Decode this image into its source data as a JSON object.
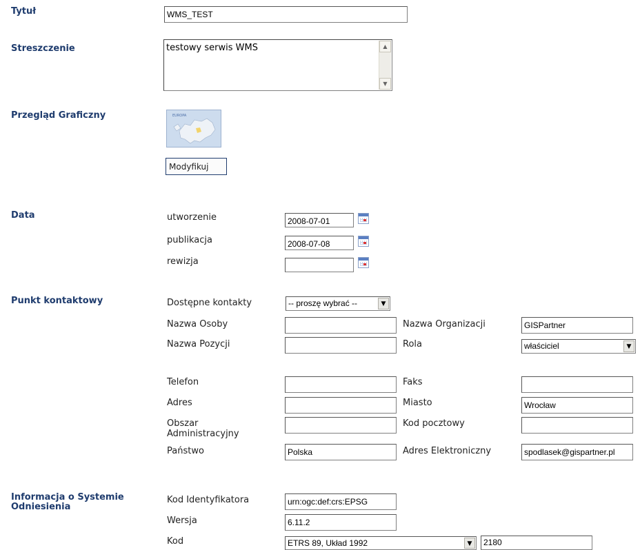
{
  "sections": {
    "title": "Tytuł",
    "abstract": "Streszczenie",
    "graphic_overview": "Przegląd Graficzny",
    "date": "Data",
    "contact_point": "Punkt kontaktowy",
    "crs_info": "Informacja o Systemie Odniesienia"
  },
  "title_value": "WMS_TEST",
  "abstract_value": "testowy serwis WMS",
  "graphic": {
    "modify_button": "Modyfikuj",
    "thumb_text": "EUROPA"
  },
  "dates": {
    "created_label": "utworzenie",
    "created_value": "2008-07-01",
    "published_label": "publikacja",
    "published_value": "2008-07-08",
    "revision_label": "rewizja",
    "revision_value": ""
  },
  "contact": {
    "available_label": "Dostępne kontakty",
    "available_value": "-- proszę wybrać --",
    "person_label": "Nazwa Osoby",
    "person_value": "",
    "org_label": "Nazwa Organizacji",
    "org_value": "GISPartner",
    "position_label": "Nazwa Pozycji",
    "position_value": "",
    "role_label": "Rola",
    "role_value": "właściciel",
    "phone_label": "Telefon",
    "phone_value": "",
    "fax_label": "Faks",
    "fax_value": "",
    "address_label": "Adres",
    "address_value": "",
    "city_label": "Miasto",
    "city_value": "Wrocław",
    "admin_area_label": "Obszar Administracyjny",
    "admin_area_value": "",
    "postal_label": "Kod pocztowy",
    "postal_value": "",
    "country_label": "Państwo",
    "country_value": "Polska",
    "email_label": "Adres Elektroniczny",
    "email_value": "spodlasek@gispartner.pl"
  },
  "crs": {
    "id_code_label": "Kod Identyfikatora",
    "id_code_value": "urn:ogc:def:crs:EPSG",
    "version_label": "Wersja",
    "version_value": "6.11.2",
    "code_label": "Kod",
    "code_select_value": "ETRS 89, Układ 1992",
    "code_value": "2180"
  },
  "icons": {
    "calendar": "calendar-icon",
    "dropdown": "chevron-down-icon",
    "scroll_up": "arrow-up-icon",
    "scroll_down": "arrow-down-icon"
  }
}
